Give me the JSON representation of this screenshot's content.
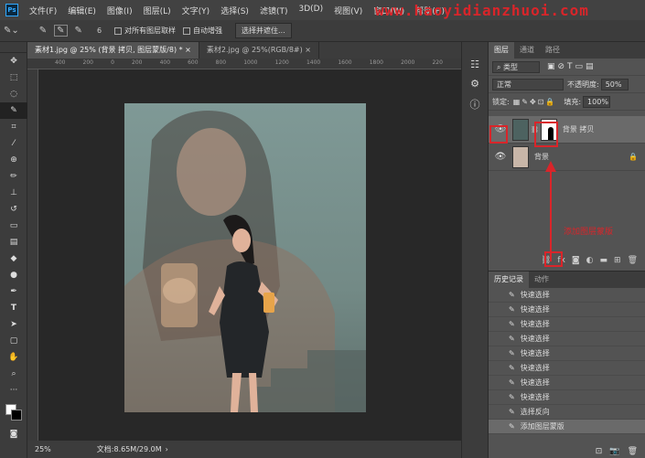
{
  "menu": [
    "文件(F)",
    "编辑(E)",
    "图像(I)",
    "图层(L)",
    "文字(Y)",
    "选择(S)",
    "滤镜(T)",
    "3D(D)",
    "视图(V)",
    "窗口(W)",
    "帮助(H)"
  ],
  "watermark": "www.haoyidianzhuoi.com",
  "options": {
    "brush_size": "6",
    "sample_all": "对所有图层取样",
    "auto_enhance": "自动增强",
    "select_subject": "选择并遮住..."
  },
  "tabs": [
    "素材1.jpg @ 25% (背景 拷贝, 图层蒙版/8) *",
    "素材2.jpg @ 25%(RGB/8#)"
  ],
  "ruler_marks": [
    "400",
    "200",
    "0",
    "200",
    "400",
    "600",
    "800",
    "1000",
    "1200",
    "1400",
    "1600",
    "1800",
    "2000",
    "220"
  ],
  "status": {
    "zoom": "25%",
    "doc": "文档:8.65M/29.0M"
  },
  "layers_panel": {
    "tabs": [
      "图层",
      "通道",
      "路径"
    ],
    "kind_label": "类型",
    "blend_mode": "正常",
    "opacity_label": "不透明度:",
    "opacity": "50%",
    "lock_label": "锁定:",
    "fill_label": "填充:",
    "fill": "100%",
    "layers": [
      {
        "name": "背景 拷贝"
      },
      {
        "name": "背景"
      }
    ],
    "annotation": "添加图层蒙版"
  },
  "history_panel": {
    "tabs": [
      "历史记录",
      "动作"
    ],
    "items": [
      "快速选择",
      "快速选择",
      "快速选择",
      "快速选择",
      "快速选择",
      "快速选择",
      "快速选择",
      "快速选择",
      "选择反向",
      "添加图层蒙版"
    ]
  },
  "colors": {
    "accent_red": "#d9252a",
    "photo_bg": "#6e8481"
  }
}
